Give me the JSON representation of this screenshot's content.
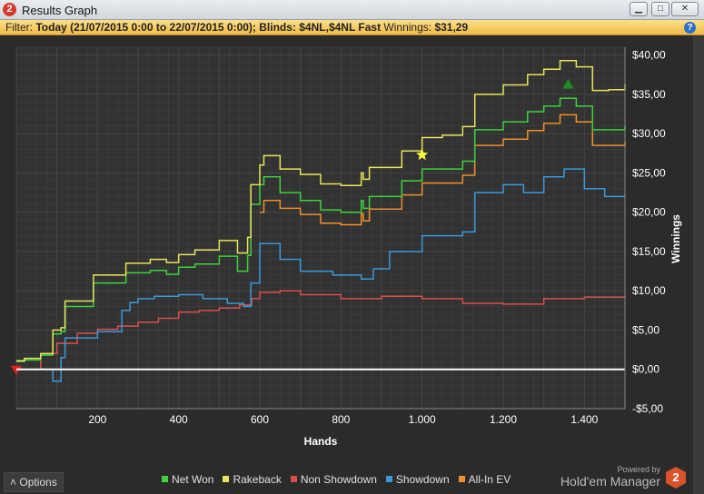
{
  "window": {
    "title": "Results Graph"
  },
  "filter": {
    "label": "Filter:",
    "text": "Today (21/07/2015 0:00 to 22/07/2015 0:00); Blinds: $4NL,$4NL Fast",
    "winnings_label": "Winnings:",
    "winnings_value": "$31,29"
  },
  "footer": {
    "options_label": "Options",
    "powered_by": "Powered by",
    "brand": "Hold'em Manager"
  },
  "icons": [
    "app-icon",
    "minimize-icon",
    "maximize-icon",
    "close-icon",
    "help-icon",
    "chevron-up-icon",
    "logo-icon"
  ],
  "chart_data": {
    "type": "line",
    "xlabel": "Hands",
    "ylabel": "Winnings",
    "xlim": [
      0,
      1500
    ],
    "ylim": [
      -5,
      41
    ],
    "x_ticks": [
      200,
      400,
      600,
      800,
      1000,
      1200,
      1400
    ],
    "x_tick_labels": [
      "200",
      "400",
      "600",
      "800",
      "1.000",
      "1.200",
      "1.400"
    ],
    "y_ticks": [
      -5,
      0,
      5,
      10,
      15,
      20,
      25,
      30,
      35,
      40
    ],
    "y_tick_labels": [
      "-$5,00",
      "$0,00",
      "$5,00",
      "$10,00",
      "$15,00",
      "$20,00",
      "$25,00",
      "$30,00",
      "$35,00",
      "$40,00"
    ],
    "grid": true,
    "legend_position": "bottom",
    "series": [
      {
        "name": "Net Won",
        "color": "#3ed23e",
        "x": [
          0,
          20,
          60,
          90,
          110,
          120,
          190,
          270,
          330,
          370,
          400,
          440,
          500,
          545,
          570,
          578,
          600,
          610,
          650,
          700,
          750,
          800,
          850,
          855,
          870,
          950,
          1000,
          1050,
          1100,
          1130,
          1200,
          1260,
          1300,
          1340,
          1380,
          1420,
          1460,
          1500
        ],
        "y": [
          1,
          1.2,
          1.8,
          4.5,
          4.8,
          8,
          11,
          12.3,
          12.6,
          12.1,
          13,
          13.4,
          14.4,
          12.5,
          14.5,
          21,
          23.5,
          24.5,
          22.5,
          21.5,
          20.3,
          20,
          21.5,
          20.5,
          22,
          24,
          25.5,
          25.5,
          26.5,
          30.5,
          31.5,
          32.8,
          33.5,
          34.5,
          33.5,
          30.5,
          30.5,
          31
        ]
      },
      {
        "name": "Rakeback",
        "color": "#e6e65a",
        "x": [
          0,
          20,
          60,
          90,
          110,
          120,
          190,
          270,
          330,
          370,
          400,
          440,
          500,
          545,
          570,
          578,
          600,
          610,
          650,
          700,
          750,
          800,
          850,
          855,
          870,
          950,
          1000,
          1050,
          1100,
          1130,
          1200,
          1260,
          1300,
          1340,
          1380,
          1420,
          1460,
          1500
        ],
        "y": [
          1.1,
          1.4,
          2,
          5,
          5.3,
          8.7,
          12,
          13.5,
          14,
          13.6,
          14.6,
          15.2,
          16.4,
          14.8,
          16.8,
          23.5,
          26,
          27.2,
          25.5,
          24.8,
          23.6,
          23.4,
          25,
          24.2,
          25.7,
          27.8,
          29.5,
          29.8,
          30.9,
          35,
          36.2,
          37.5,
          38.2,
          39.3,
          38.5,
          35.5,
          35.6,
          36.3
        ]
      },
      {
        "name": "Non Showdown",
        "color": "#d94f4f",
        "x": [
          0,
          60,
          100,
          150,
          200,
          250,
          300,
          350,
          400,
          450,
          500,
          550,
          580,
          600,
          650,
          700,
          800,
          900,
          1000,
          1100,
          1200,
          1300,
          1400,
          1500
        ],
        "y": [
          0,
          2,
          3.3,
          4.6,
          5.1,
          5.5,
          6,
          6.5,
          7.3,
          7.5,
          7.8,
          8.2,
          9,
          9.8,
          10,
          9.5,
          9,
          9.3,
          9,
          8.4,
          8.3,
          9,
          9.2,
          9.3
        ]
      },
      {
        "name": "Showdown",
        "color": "#3a9ad9",
        "x": [
          0,
          80,
          90,
          110,
          120,
          200,
          260,
          280,
          300,
          340,
          400,
          460,
          520,
          560,
          578,
          600,
          650,
          700,
          780,
          850,
          880,
          920,
          1000,
          1100,
          1130,
          1200,
          1250,
          1300,
          1350,
          1400,
          1450,
          1500
        ],
        "y": [
          0,
          0,
          -1.5,
          1.5,
          4,
          4.8,
          7.5,
          8.5,
          9,
          9.3,
          9.5,
          9,
          8.4,
          8,
          11,
          16,
          14,
          12.5,
          12,
          11.5,
          12.8,
          15,
          17,
          17.5,
          22.5,
          23.5,
          22.5,
          24.5,
          25.5,
          23,
          22,
          22
        ]
      },
      {
        "name": "All-In EV",
        "color": "#f0902a",
        "x": [
          600,
          610,
          650,
          700,
          750,
          800,
          850,
          855,
          870,
          950,
          1000,
          1050,
          1100,
          1130,
          1200,
          1260,
          1300,
          1340,
          1380,
          1420,
          1460,
          1500
        ],
        "y": [
          20,
          21.5,
          20.5,
          19.7,
          18.6,
          18.4,
          19.8,
          18.9,
          20.4,
          22.2,
          23.7,
          23.7,
          24.7,
          28.5,
          29.3,
          30.4,
          31.3,
          32.4,
          31.5,
          28.5,
          28.5,
          29
        ]
      }
    ],
    "markers": [
      {
        "kind": "start-triangle",
        "x": 0,
        "y": 0,
        "color": "#e02020"
      },
      {
        "kind": "star",
        "x": 1000,
        "y": 27.3,
        "color": "#ffff40"
      },
      {
        "kind": "peak-triangle",
        "x": 1360,
        "y": 36.3,
        "color": "#1f8a1f"
      }
    ]
  }
}
